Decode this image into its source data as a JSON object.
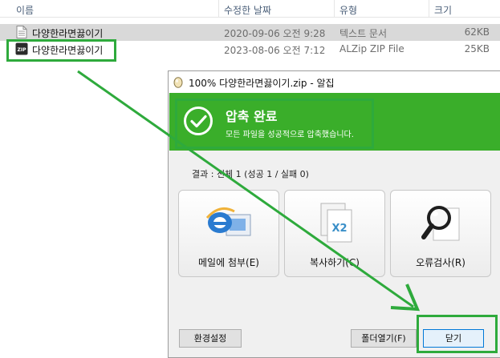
{
  "explorer": {
    "columns": {
      "name": "이름",
      "date": "수정한 날짜",
      "type": "유형",
      "size": "크기"
    },
    "files": [
      {
        "icon": "text-file-icon",
        "name": "다양한라면끓이기",
        "date": "2020-09-06 오전 9:28",
        "type": "텍스트 문서",
        "size": "62KB"
      },
      {
        "icon": "zip-file-icon",
        "icon_text": "ZIP",
        "name": "다양한라면끓이기",
        "date": "2023-08-06 오전 7:12",
        "type": "ALZip ZIP File",
        "size": "25KB"
      }
    ]
  },
  "dialog": {
    "title": "100% 다양한라면끓이기.zip - 알집",
    "banner": {
      "title": "압축 완료",
      "subtitle": "모든 파일을 성공적으로 압축했습니다.",
      "color": "#3aae2a"
    },
    "result": "결과 : 전체 1 (성공 1 / 실패 0)",
    "actions": [
      {
        "icon": "email-attach-icon",
        "label": "메일에 첨부(E)"
      },
      {
        "icon": "copy-x2-icon",
        "icon_text": "X2",
        "label": "복사하기(C)"
      },
      {
        "icon": "error-check-icon",
        "label": "오류검사(R)"
      }
    ],
    "buttons": {
      "settings": "환경설정",
      "open_folder": "폴더열기(F)",
      "close": "닫기"
    }
  },
  "annotation": {
    "color": "#2eaa3c"
  }
}
